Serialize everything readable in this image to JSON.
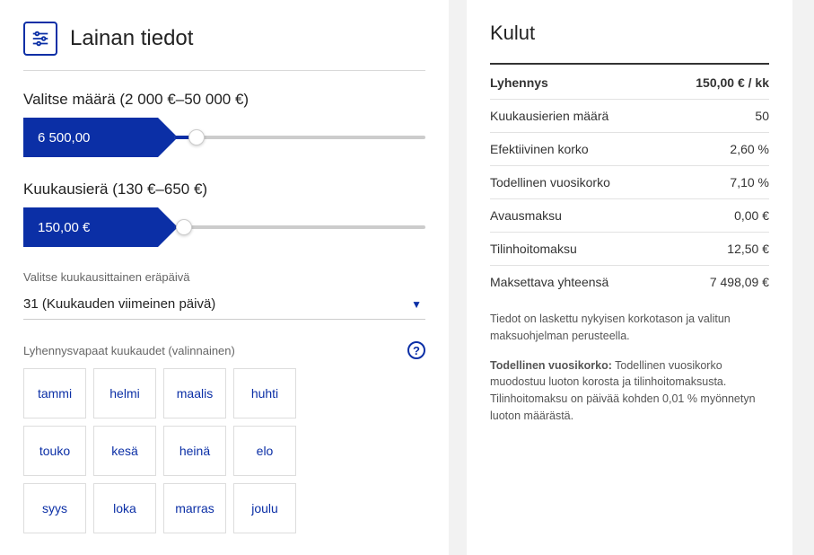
{
  "left": {
    "title": "Lainan tiedot",
    "amount": {
      "label": "Valitse määrä (2 000 €–50 000 €)",
      "value": "6 500,00",
      "sliderPct": 9
    },
    "monthly": {
      "label": "Kuukausierä (130 €–650 €)",
      "value": "150,00 €",
      "sliderPct": 4
    },
    "dueDate": {
      "label": "Valitse kuukausittainen eräpäivä",
      "selected": "31 (Kuukauden viimeinen päivä)"
    },
    "freeMonths": {
      "label": "Lyhennysvapaat kuukaudet (valinnainen)",
      "months": [
        "tammi",
        "helmi",
        "maalis",
        "huhti",
        "touko",
        "kesä",
        "heinä",
        "elo",
        "syys",
        "loka",
        "marras",
        "joulu"
      ]
    }
  },
  "right": {
    "title": "Kulut",
    "rows": [
      {
        "label": "Lyhennys",
        "value": "150,00 € / kk",
        "first": true
      },
      {
        "label": "Kuukausierien määrä",
        "value": "50"
      },
      {
        "label": "Efektiivinen korko",
        "value": "2,60 %"
      },
      {
        "label": "Todellinen vuosikorko",
        "value": "7,10 %"
      },
      {
        "label": "Avausmaksu",
        "value": "0,00 €"
      },
      {
        "label": "Tilinhoitomaksu",
        "value": "12,50 €"
      },
      {
        "label": "Maksettava yhteensä",
        "value": "7 498,09 €"
      }
    ],
    "foot1": "Tiedot on laskettu nykyisen korkotason ja valitun maksuohjelman perusteella.",
    "foot2_bold": "Todellinen vuosikorko:",
    "foot2_rest": " Todellinen vuosikorko muodostuu luoton korosta ja tilinhoitomaksusta. Tilinhoitomaksu on päivää kohden 0,01 % myönnetyn luoton määrästä."
  }
}
